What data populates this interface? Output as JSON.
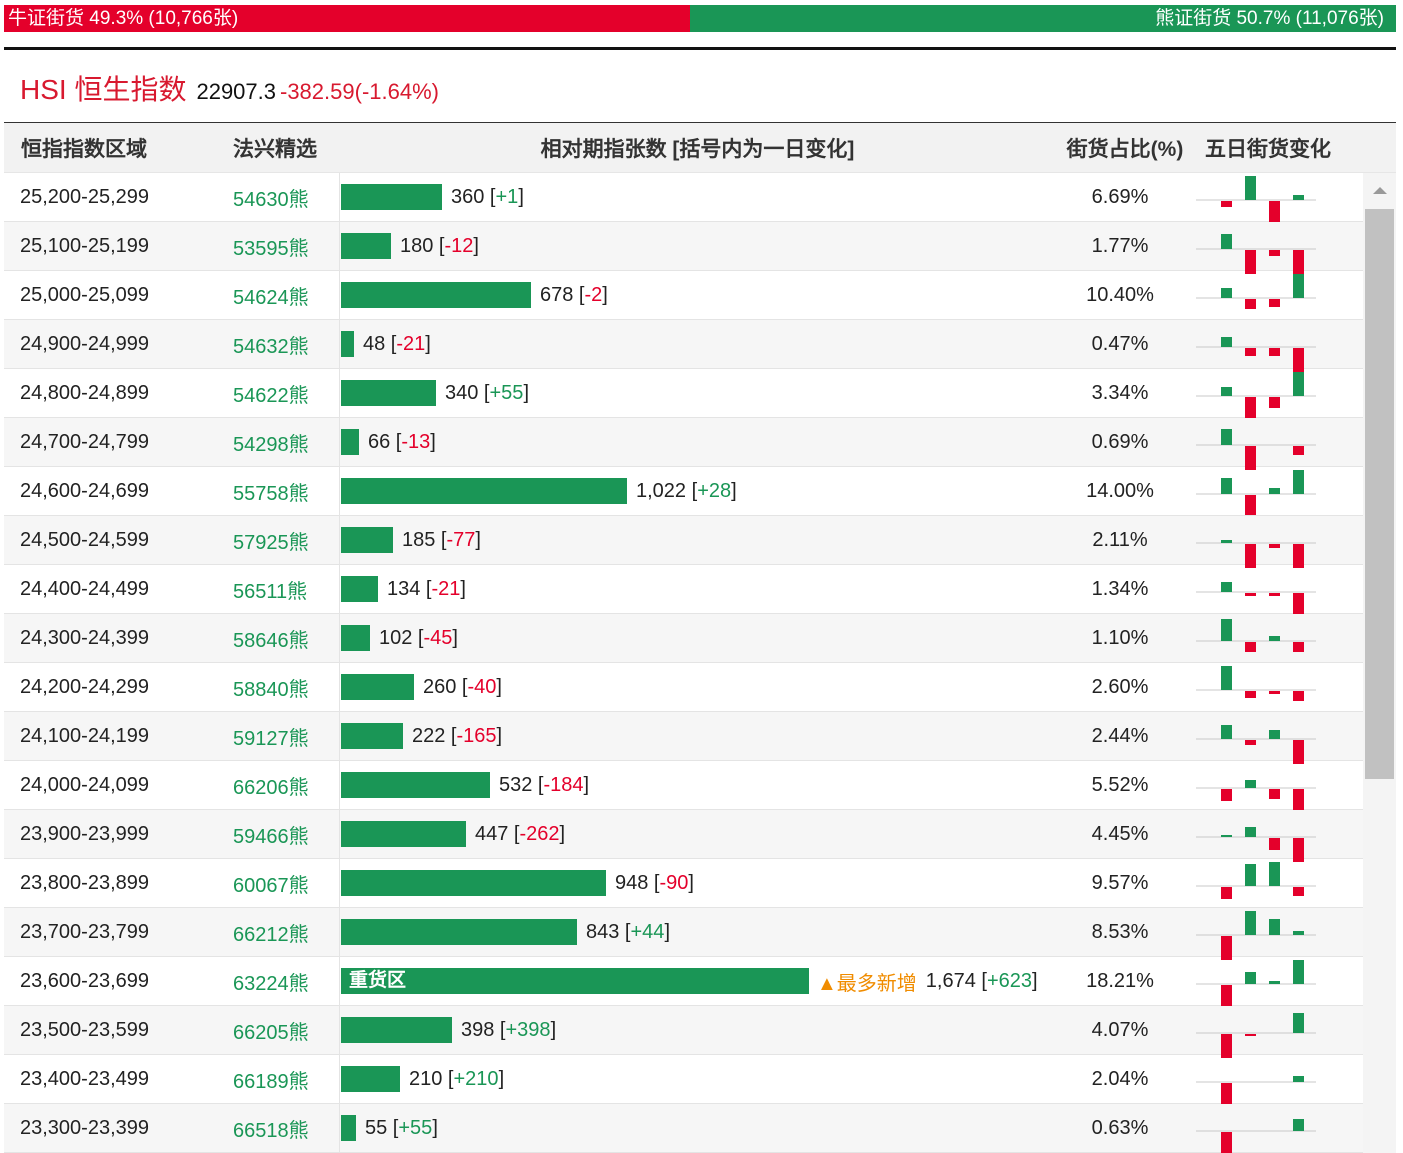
{
  "ratio": {
    "bull_label": "牛证街货 49.3% (10,766张)",
    "bear_label": "熊证街货 50.7% (11,076张)",
    "bull_pct": 49.3
  },
  "index": {
    "name": "HSI 恒生指数",
    "price": "22907.3",
    "change": "-382.59(-1.64%)"
  },
  "headers": [
    "恒指指数区域",
    "法兴精选",
    "相对期指张数 [括号内为一日变化]",
    "街货占比(%)",
    "五日街货变化"
  ],
  "colors": {
    "green": "#1a9656",
    "red": "#e4002b"
  },
  "max_count": 1674,
  "rows": [
    {
      "range": "25,200-25,299",
      "code": "54630熊",
      "count": 360,
      "count_label": "360",
      "delta": "+1",
      "pct": "6.69%",
      "five": [
        0,
        -6,
        24,
        -21,
        5
      ]
    },
    {
      "range": "25,100-25,199",
      "code": "53595熊",
      "count": 180,
      "count_label": "180",
      "delta": "-12",
      "pct": "1.77%",
      "five": [
        0,
        15,
        -24,
        -6,
        -24
      ]
    },
    {
      "range": "25,000-25,099",
      "code": "54624熊",
      "count": 678,
      "count_label": "678",
      "delta": "-2",
      "pct": "10.40%",
      "five": [
        0,
        10,
        -10,
        -8,
        24
      ]
    },
    {
      "range": "24,900-24,999",
      "code": "54632熊",
      "count": 48,
      "count_label": "48",
      "delta": "-21",
      "pct": "0.47%",
      "five": [
        0,
        10,
        -8,
        -8,
        -24
      ]
    },
    {
      "range": "24,800-24,899",
      "code": "54622熊",
      "count": 340,
      "count_label": "340",
      "delta": "+55",
      "pct": "3.34%",
      "five": [
        0,
        9,
        -22,
        -11,
        24
      ]
    },
    {
      "range": "24,700-24,799",
      "code": "54298熊",
      "count": 66,
      "count_label": "66",
      "delta": "-13",
      "pct": "0.69%",
      "five": [
        0,
        16,
        -24,
        0,
        -9
      ]
    },
    {
      "range": "24,600-24,699",
      "code": "55758熊",
      "count": 1022,
      "count_label": "1,022",
      "delta": "+28",
      "pct": "14.00%",
      "five": [
        0,
        16,
        -20,
        6,
        24
      ]
    },
    {
      "range": "24,500-24,599",
      "code": "57925熊",
      "count": 185,
      "count_label": "185",
      "delta": "-77",
      "pct": "2.11%",
      "five": [
        0,
        3,
        -24,
        -4,
        -24
      ]
    },
    {
      "range": "24,400-24,499",
      "code": "56511熊",
      "count": 134,
      "count_label": "134",
      "delta": "-21",
      "pct": "1.34%",
      "five": [
        0,
        10,
        -3,
        -3,
        -24
      ]
    },
    {
      "range": "24,300-24,399",
      "code": "58646熊",
      "count": 102,
      "count_label": "102",
      "delta": "-45",
      "pct": "1.10%",
      "five": [
        0,
        22,
        -10,
        5,
        -10
      ]
    },
    {
      "range": "24,200-24,299",
      "code": "58840熊",
      "count": 260,
      "count_label": "260",
      "delta": "-40",
      "pct": "2.60%",
      "five": [
        0,
        24,
        -7,
        -3,
        -10
      ]
    },
    {
      "range": "24,100-24,199",
      "code": "59127熊",
      "count": 222,
      "count_label": "222",
      "delta": "-165",
      "pct": "2.44%",
      "five": [
        0,
        14,
        -5,
        9,
        -24
      ]
    },
    {
      "range": "24,000-24,099",
      "code": "66206熊",
      "count": 532,
      "count_label": "532",
      "delta": "-184",
      "pct": "5.52%",
      "five": [
        0,
        -12,
        8,
        -10,
        -24
      ]
    },
    {
      "range": "23,900-23,999",
      "code": "59466熊",
      "count": 447,
      "count_label": "447",
      "delta": "-262",
      "pct": "4.45%",
      "five": [
        0,
        2,
        10,
        -12,
        -24
      ]
    },
    {
      "range": "23,800-23,899",
      "code": "60067熊",
      "count": 948,
      "count_label": "948",
      "delta": "-90",
      "pct": "9.57%",
      "five": [
        0,
        -12,
        22,
        24,
        -9
      ]
    },
    {
      "range": "23,700-23,799",
      "code": "66212熊",
      "count": 843,
      "count_label": "843",
      "delta": "+44",
      "pct": "8.53%",
      "five": [
        0,
        -24,
        24,
        16,
        4
      ]
    },
    {
      "range": "23,600-23,699",
      "code": "63224熊",
      "count": 1674,
      "count_label": "1,674",
      "delta": "+623",
      "pct": "18.21%",
      "five": [
        0,
        -24,
        12,
        3,
        24
      ],
      "bar_label": "重货区",
      "hot_label": "▲最多新增"
    },
    {
      "range": "23,500-23,599",
      "code": "66205熊",
      "count": 398,
      "count_label": "398",
      "delta": "+398",
      "pct": "4.07%",
      "five": [
        0,
        -24,
        -2,
        0,
        20
      ]
    },
    {
      "range": "23,400-23,499",
      "code": "66189熊",
      "count": 210,
      "count_label": "210",
      "delta": "+210",
      "pct": "2.04%",
      "five": [
        0,
        -24,
        0,
        0,
        6
      ]
    },
    {
      "range": "23,300-23,399",
      "code": "66518熊",
      "count": 55,
      "count_label": "55",
      "delta": "+55",
      "pct": "0.63%",
      "five": [
        0,
        -24,
        0,
        0,
        12
      ]
    }
  ]
}
